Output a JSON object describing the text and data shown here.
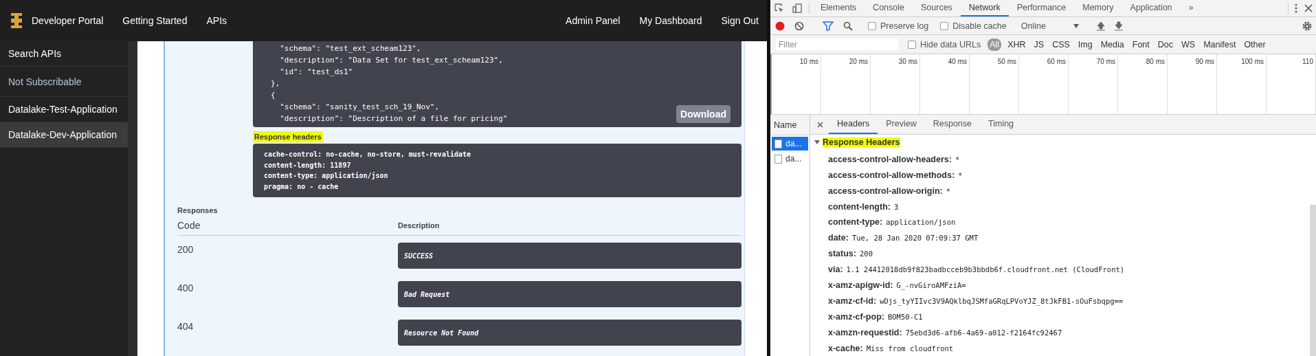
{
  "navbar": {
    "brand": "Developer Portal",
    "left_links": [
      "Getting Started",
      "APIs"
    ],
    "right_links": [
      "Admin Panel",
      "My Dashboard",
      "Sign Out"
    ]
  },
  "sidebar": {
    "items": [
      {
        "label": "Search APIs",
        "kind": "link",
        "selected": false
      },
      {
        "label": "Not Subscribable",
        "kind": "heading",
        "selected": false
      },
      {
        "label": "Datalake-Test-Application",
        "kind": "link",
        "selected": false
      },
      {
        "label": "Datalake-Dev-Application",
        "kind": "link",
        "selected": true
      }
    ]
  },
  "response_body": {
    "lines": [
      "  \"schema\": \"test_ext_scheam123\",",
      "  \"description\": \"Data Set for test_ext_scheam123\",",
      "  \"id\": \"test_ds1\"",
      "},",
      "{",
      "  \"schema\": \"sanity_test_sch_19_Nov\",",
      "  \"description\": \"Description of a file for pricing\""
    ],
    "download_button": "Download"
  },
  "response_headers": {
    "label": "Response headers",
    "lines": [
      "cache-control: no-cache, no-store, must-revalidate",
      "content-length: 11897",
      "content-type: application/json",
      "pragma: no - cache"
    ]
  },
  "responses": {
    "title": "Responses",
    "columns": [
      "Code",
      "Description"
    ],
    "rows": [
      {
        "code": "200",
        "description": "SUCCESS"
      },
      {
        "code": "400",
        "description": "Bad Request"
      },
      {
        "code": "404",
        "description": "Resource Not Found"
      }
    ]
  },
  "devtools": {
    "tabs": [
      {
        "label": "Elements",
        "selected": false
      },
      {
        "label": "Console",
        "selected": false
      },
      {
        "label": "Sources",
        "selected": false
      },
      {
        "label": "Network",
        "selected": true
      },
      {
        "label": "Performance",
        "selected": false
      },
      {
        "label": "Memory",
        "selected": false
      },
      {
        "label": "Application",
        "selected": false
      }
    ],
    "more_tabs": "»",
    "toolbar": {
      "recording": true,
      "preserve_log": {
        "label": "Preserve log",
        "checked": false
      },
      "disable_cache": {
        "label": "Disable cache",
        "checked": false
      },
      "throttling": "Online"
    },
    "filter": {
      "placeholder": "Filter",
      "hide_data_urls": {
        "label": "Hide data URLs",
        "checked": false
      },
      "types": [
        {
          "label": "All",
          "selected": true
        },
        {
          "label": "XHR",
          "selected": false
        },
        {
          "label": "JS",
          "selected": false
        },
        {
          "label": "CSS",
          "selected": false
        },
        {
          "label": "Img",
          "selected": false
        },
        {
          "label": "Media",
          "selected": false
        },
        {
          "label": "Font",
          "selected": false
        },
        {
          "label": "Doc",
          "selected": false
        },
        {
          "label": "WS",
          "selected": false
        },
        {
          "label": "Manifest",
          "selected": false
        },
        {
          "label": "Other",
          "selected": false
        }
      ]
    },
    "timeline_ticks": [
      "10 ms",
      "20 ms",
      "30 ms",
      "40 ms",
      "50 ms",
      "60 ms",
      "70 ms",
      "80 ms",
      "90 ms",
      "100 ms",
      "110"
    ],
    "name_column": {
      "header": "Name",
      "items": [
        {
          "label": "da...",
          "selected": true
        },
        {
          "label": "da...",
          "selected": false
        }
      ]
    },
    "detail_tabs": [
      {
        "label": "Headers",
        "selected": true
      },
      {
        "label": "Preview",
        "selected": false
      },
      {
        "label": "Response",
        "selected": false
      },
      {
        "label": "Timing",
        "selected": false
      }
    ],
    "section": {
      "title": "Response Headers",
      "expanded": true,
      "headers": [
        {
          "name": "access-control-allow-headers:",
          "value": "*"
        },
        {
          "name": "access-control-allow-methods:",
          "value": "*"
        },
        {
          "name": "access-control-allow-origin:",
          "value": "*"
        },
        {
          "name": "content-length:",
          "value": "3"
        },
        {
          "name": "content-type:",
          "value": "application/json"
        },
        {
          "name": "date:",
          "value": "Tue, 28 Jan 2020 07:09:37 GMT"
        },
        {
          "name": "status:",
          "value": "200"
        },
        {
          "name": "via:",
          "value": "1.1 24412018db9f823badbcceb9b3bbdb6f.cloudfront.net (CloudFront)"
        },
        {
          "name": "x-amz-apigw-id:",
          "value": "G_-nvGiroAMFziA="
        },
        {
          "name": "x-amz-cf-id:",
          "value": "wDjs_tyYIIvc3V9AQklbqJSMfaGRqLPVoYJZ_8tJkFB1-sOuFsbqpg=="
        },
        {
          "name": "x-amz-cf-pop:",
          "value": "BOM50-C1"
        },
        {
          "name": "x-amzn-requestid:",
          "value": "75ebd3d6-afb6-4a69-a012-f2164fc92467"
        },
        {
          "name": "x-cache:",
          "value": "Miss from cloudfront"
        }
      ]
    }
  }
}
